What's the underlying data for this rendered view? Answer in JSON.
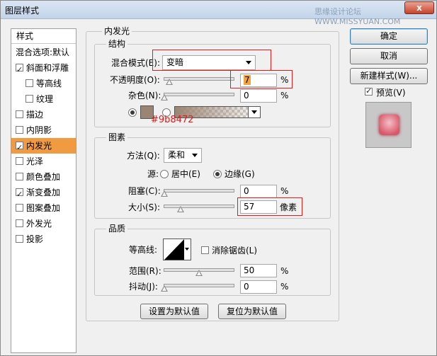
{
  "window": {
    "title": "图层样式",
    "watermark": "思缘设计论坛 WWW.MISSYUAN.COM",
    "close": "x"
  },
  "left_list": {
    "header": "样式",
    "items": [
      {
        "label": "混合选项:默认",
        "checkbox": false,
        "checked": false,
        "indent": false,
        "selected": false
      },
      {
        "label": "斜面和浮雕",
        "checkbox": true,
        "checked": true,
        "indent": false,
        "selected": false
      },
      {
        "label": "等高线",
        "checkbox": true,
        "checked": false,
        "indent": true,
        "selected": false
      },
      {
        "label": "纹理",
        "checkbox": true,
        "checked": false,
        "indent": true,
        "selected": false
      },
      {
        "label": "描边",
        "checkbox": true,
        "checked": false,
        "indent": false,
        "selected": false
      },
      {
        "label": "内阴影",
        "checkbox": true,
        "checked": false,
        "indent": false,
        "selected": false
      },
      {
        "label": "内发光",
        "checkbox": true,
        "checked": true,
        "indent": false,
        "selected": true
      },
      {
        "label": "光泽",
        "checkbox": true,
        "checked": false,
        "indent": false,
        "selected": false
      },
      {
        "label": "颜色叠加",
        "checkbox": true,
        "checked": false,
        "indent": false,
        "selected": false
      },
      {
        "label": "渐变叠加",
        "checkbox": true,
        "checked": true,
        "indent": false,
        "selected": false
      },
      {
        "label": "图案叠加",
        "checkbox": true,
        "checked": false,
        "indent": false,
        "selected": false
      },
      {
        "label": "外发光",
        "checkbox": true,
        "checked": false,
        "indent": false,
        "selected": false
      },
      {
        "label": "投影",
        "checkbox": true,
        "checked": false,
        "indent": false,
        "selected": false
      }
    ]
  },
  "panel": {
    "title": "内发光",
    "structure": {
      "title": "结构",
      "blend_mode_label": "混合模式(E):",
      "blend_mode_value": "变暗",
      "opacity_label": "不透明度(O):",
      "opacity_value": "7",
      "opacity_fraction": 0.07,
      "noise_label": "杂色(N):",
      "noise_value": "0",
      "noise_fraction": 0,
      "percent": "%",
      "color_annotation": "#9b8472",
      "glow_color": "#9b8472"
    },
    "elements": {
      "title": "图素",
      "technique_label": "方法(Q):",
      "technique_value": "柔和",
      "source_label": "源:",
      "source_center": "居中(E)",
      "source_edge": "边缘(G)",
      "choke_label": "阻塞(C):",
      "choke_value": "0",
      "choke_fraction": 0,
      "size_label": "大小(S):",
      "size_value": "57",
      "size_fraction": 0.23,
      "size_unit": "像素",
      "percent": "%"
    },
    "quality": {
      "title": "品质",
      "contour_label": "等高线:",
      "antialias_label": "消除锯齿(L)",
      "range_label": "范围(R):",
      "range_value": "50",
      "range_fraction": 0.5,
      "jitter_label": "抖动(J):",
      "jitter_value": "0",
      "jitter_fraction": 0,
      "percent": "%"
    },
    "make_default": "设置为默认值",
    "reset_default": "复位为默认值"
  },
  "right": {
    "ok": "确定",
    "cancel": "取消",
    "new_style": "新建样式(W)...",
    "preview_label": "预览(V)",
    "preview_checked": true
  }
}
